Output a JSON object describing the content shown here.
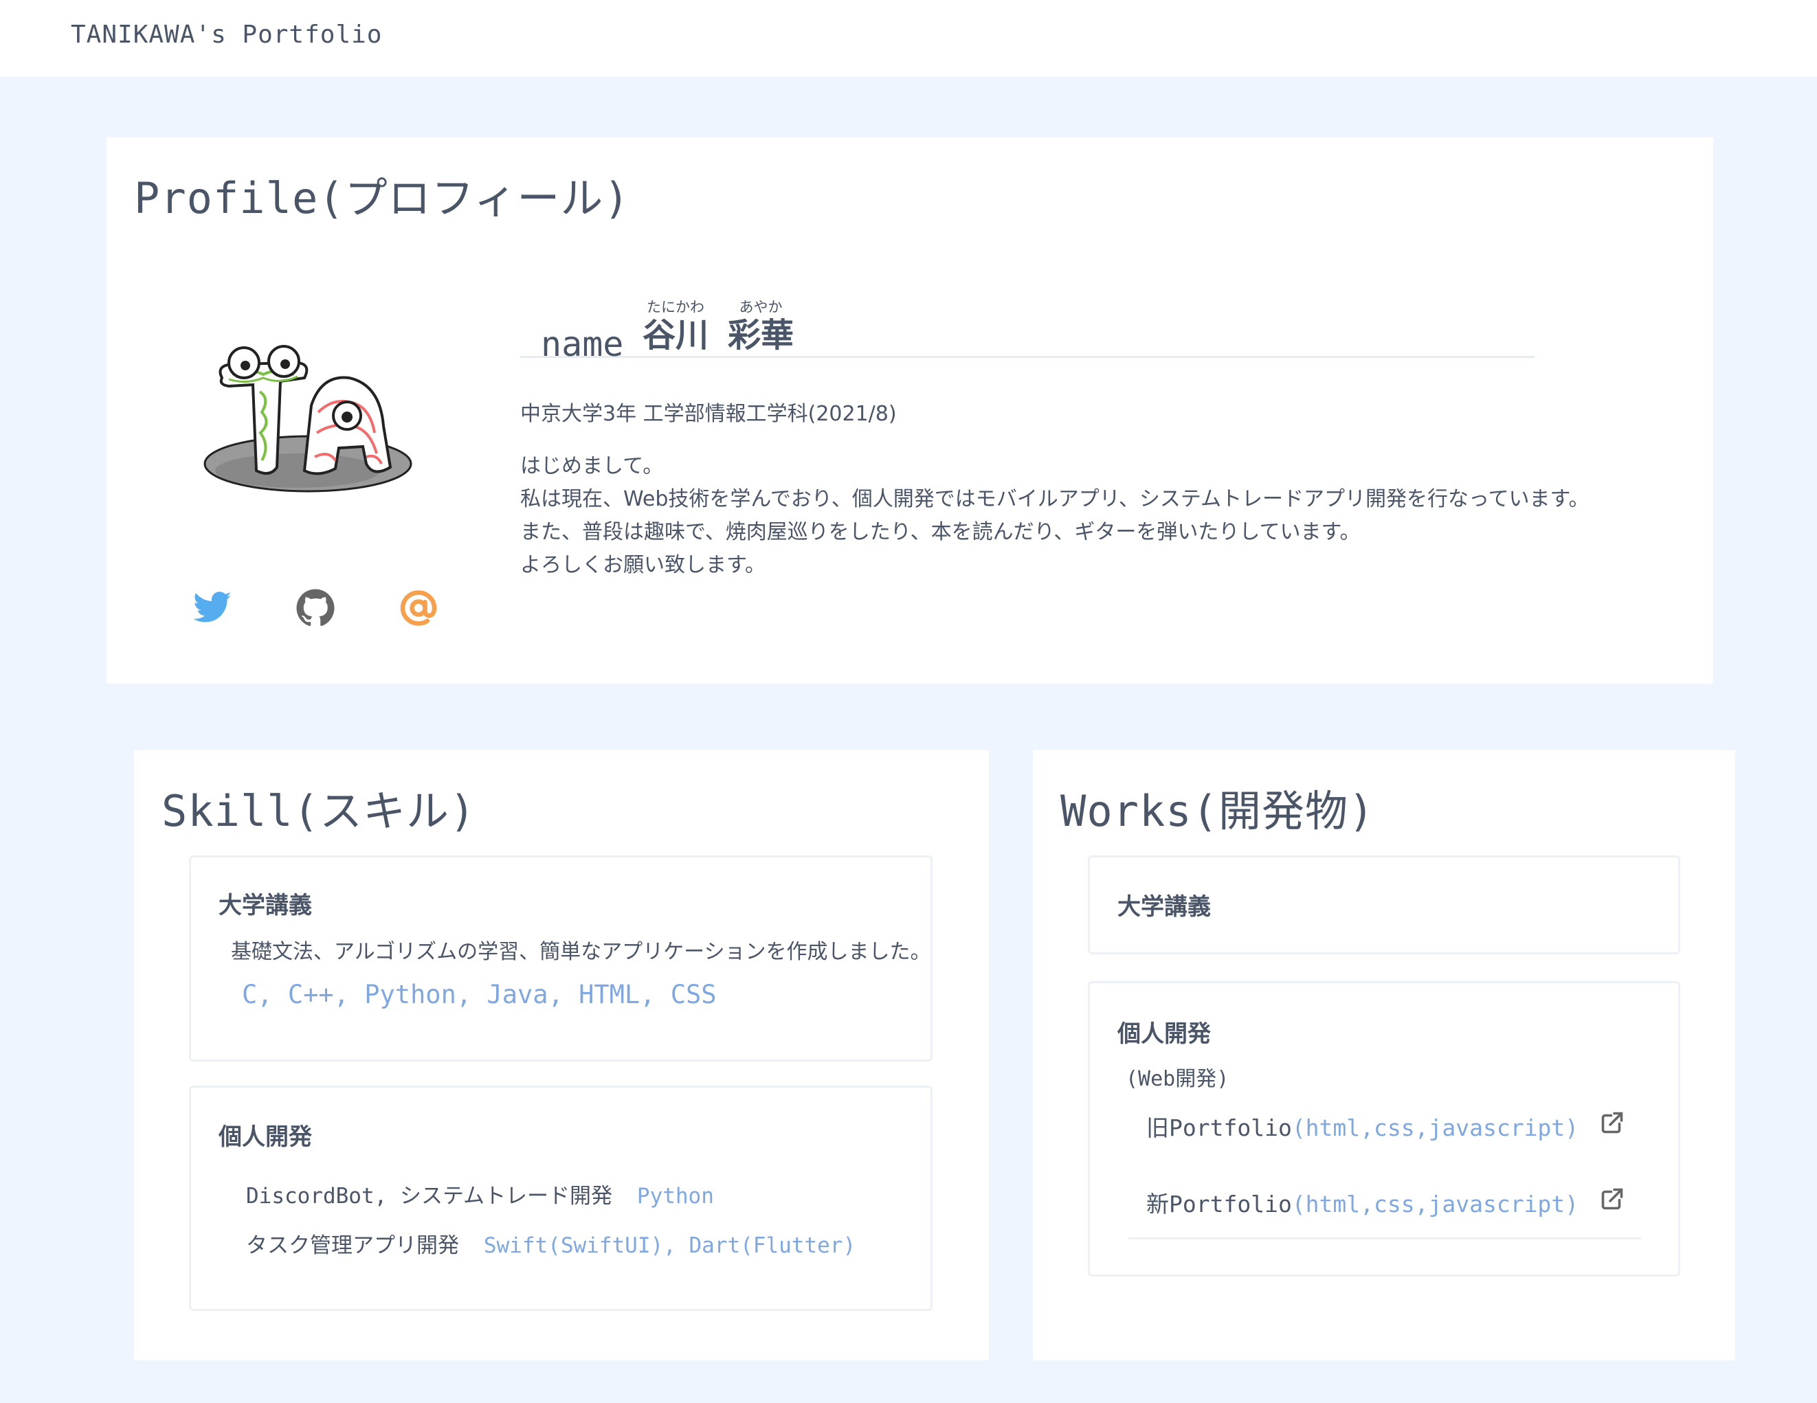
{
  "header": {
    "site_title": "TANIKAWA's Portfolio"
  },
  "profile": {
    "title": "Profile(プロフィール)",
    "name_label": "name",
    "family_name": "谷川",
    "family_name_ruby": "たにかわ",
    "given_name": "彩華",
    "given_name_ruby": "あやか",
    "affiliation": "中京大学3年 工学部情報工学科(2021/8)",
    "intro_lines": [
      "はじめまして。",
      "私は現在、Web技術を学んでおり、個人開発ではモバイルアプリ、システムトレードアプリ開発を行なっています。",
      "また、普段は趣味で、焼肉屋巡りをしたり、本を読んだり、ギターを弾いたりしています。",
      "よろしくお願い致します。"
    ],
    "avatar_icon": "ta-initials-doodle",
    "social": [
      {
        "icon": "twitter-icon",
        "color": "#55acee"
      },
      {
        "icon": "github-icon",
        "color": "#666666"
      },
      {
        "icon": "email-at-icon",
        "color": "#f6a04d"
      }
    ]
  },
  "skill": {
    "title": "Skill(スキル)",
    "university": {
      "heading": "大学講義",
      "description": "基礎文法、アルゴリズムの学習、簡単なアプリケーションを作成しました。",
      "languages": "C, C++, Python, Java, HTML, CSS"
    },
    "personal": {
      "heading": "個人開発",
      "items": [
        {
          "label": "DiscordBot, システムトレード開発",
          "tech": "Python"
        },
        {
          "label": "タスク管理アプリ開発",
          "tech": "Swift(SwiftUI), Dart(Flutter)"
        }
      ]
    }
  },
  "works": {
    "title": "Works(開発物)",
    "university": {
      "heading": "大学講義"
    },
    "personal": {
      "heading": "個人開発",
      "category": "(Web開発)",
      "items": [
        {
          "label": "旧Portfolio",
          "tech": "(html,css,javascript)"
        },
        {
          "label": "新Portfolio",
          "tech": "(html,css,javascript)"
        }
      ]
    }
  },
  "colors": {
    "background": "#eef5ff",
    "card": "#ffffff",
    "text": "#4a5568",
    "accent": "#7fa8e3"
  }
}
